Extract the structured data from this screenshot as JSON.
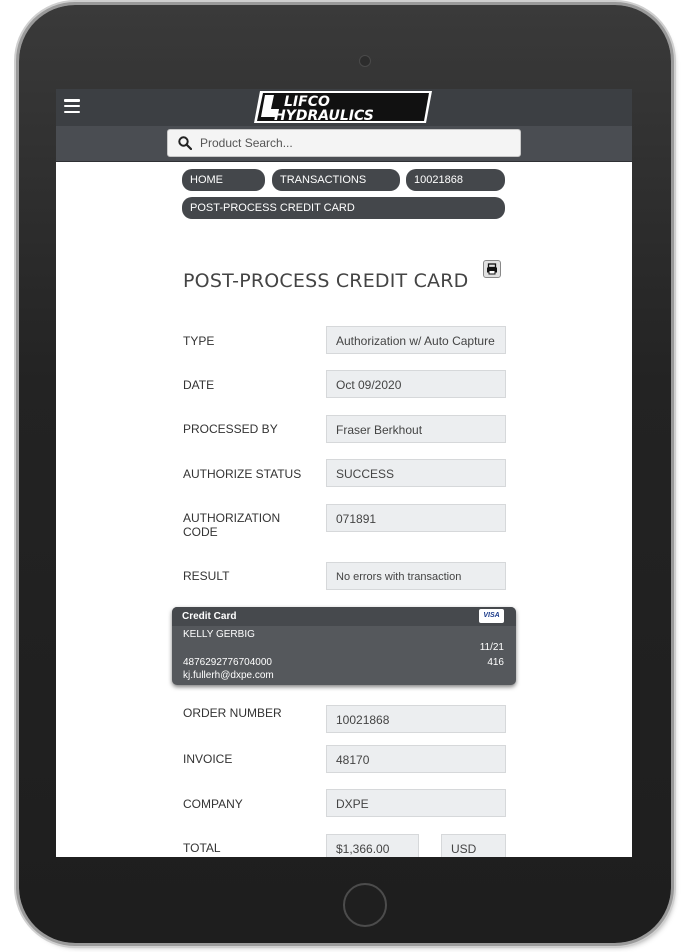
{
  "header": {
    "logo_text": "LIFCO HYDRAULICS"
  },
  "search": {
    "placeholder": "Product Search..."
  },
  "breadcrumbs": [
    "HOME",
    "TRANSACTIONS",
    "10021868",
    "POST-PROCESS CREDIT CARD"
  ],
  "page": {
    "title": "POST-PROCESS CREDIT CARD"
  },
  "fields": {
    "type": {
      "label": "TYPE",
      "value": "Authorization w/ Auto Capture"
    },
    "date": {
      "label": "DATE",
      "value": "Oct 09/2020"
    },
    "processed_by": {
      "label": "PROCESSED BY",
      "value": "Fraser Berkhout"
    },
    "authorize_status": {
      "label": "AUTHORIZE STATUS",
      "value": "SUCCESS"
    },
    "authorization_code": {
      "label": "AUTHORIZATION CODE",
      "value": "071891"
    },
    "result": {
      "label": "RESULT",
      "value": "No errors with transaction"
    },
    "order_number": {
      "label": "ORDER NUMBER",
      "value": "10021868"
    },
    "invoice": {
      "label": "INVOICE",
      "value": "48170"
    },
    "company": {
      "label": "COMPANY",
      "value": "DXPE"
    },
    "total": {
      "label": "TOTAL",
      "value": "$1,366.00",
      "currency": "USD"
    }
  },
  "credit_card": {
    "title": "Credit Card",
    "brand": "VISA",
    "name": "KELLY GERBIG",
    "expiry": "11/21",
    "number": "4876292776704000",
    "cvv": "416",
    "email": "kj.fullerh@dxpe.com"
  },
  "colors": {
    "topbar": "#3c3f43",
    "crumb": "#44474b",
    "card": "#55585c"
  }
}
